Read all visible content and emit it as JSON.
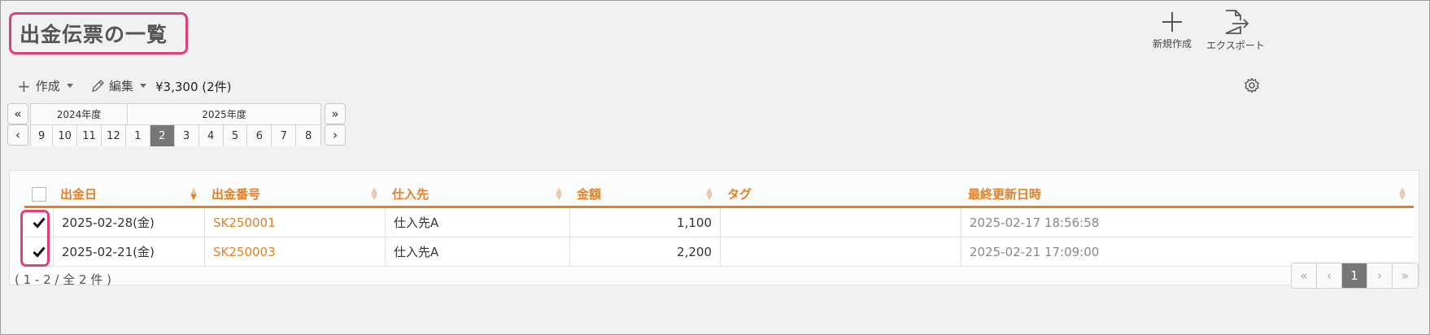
{
  "title": "出金伝票の一覧",
  "top_actions": {
    "new_label": "新規作成",
    "export_label": "エクスポート"
  },
  "toolbar": {
    "create_label": "作成",
    "edit_label": "編集",
    "total": "¥3,300 (2件)"
  },
  "period": {
    "years": [
      "2024年度",
      "2025年度"
    ],
    "months": [
      "9",
      "10",
      "11",
      "12",
      "1",
      "2",
      "3",
      "4",
      "5",
      "6",
      "7",
      "8"
    ],
    "selected_month": "2",
    "nav_first": "«",
    "nav_prev": "‹",
    "nav_last": "»",
    "nav_next": "›"
  },
  "table": {
    "columns": [
      "出金日",
      "出金番号",
      "仕入先",
      "金額",
      "タグ",
      "最終更新日時"
    ],
    "rows": [
      {
        "date": "2025-02-28(金)",
        "number": "SK250001",
        "supplier": "仕入先A",
        "amount": "1,100",
        "tag": "",
        "updated": "2025-02-17 18:56:58",
        "checked": true
      },
      {
        "date": "2025-02-21(金)",
        "number": "SK250003",
        "supplier": "仕入先A",
        "amount": "2,200",
        "tag": "",
        "updated": "2025-02-21 17:09:00",
        "checked": true
      }
    ]
  },
  "footer": {
    "range": "( 1 - 2 / 全 2 件 )",
    "pages": [
      "«",
      "‹",
      "1",
      "›",
      "»"
    ],
    "current_page": "1"
  },
  "colors": {
    "accent": "#e67e22",
    "highlight": "#e0407a",
    "active_bg": "#777777"
  }
}
